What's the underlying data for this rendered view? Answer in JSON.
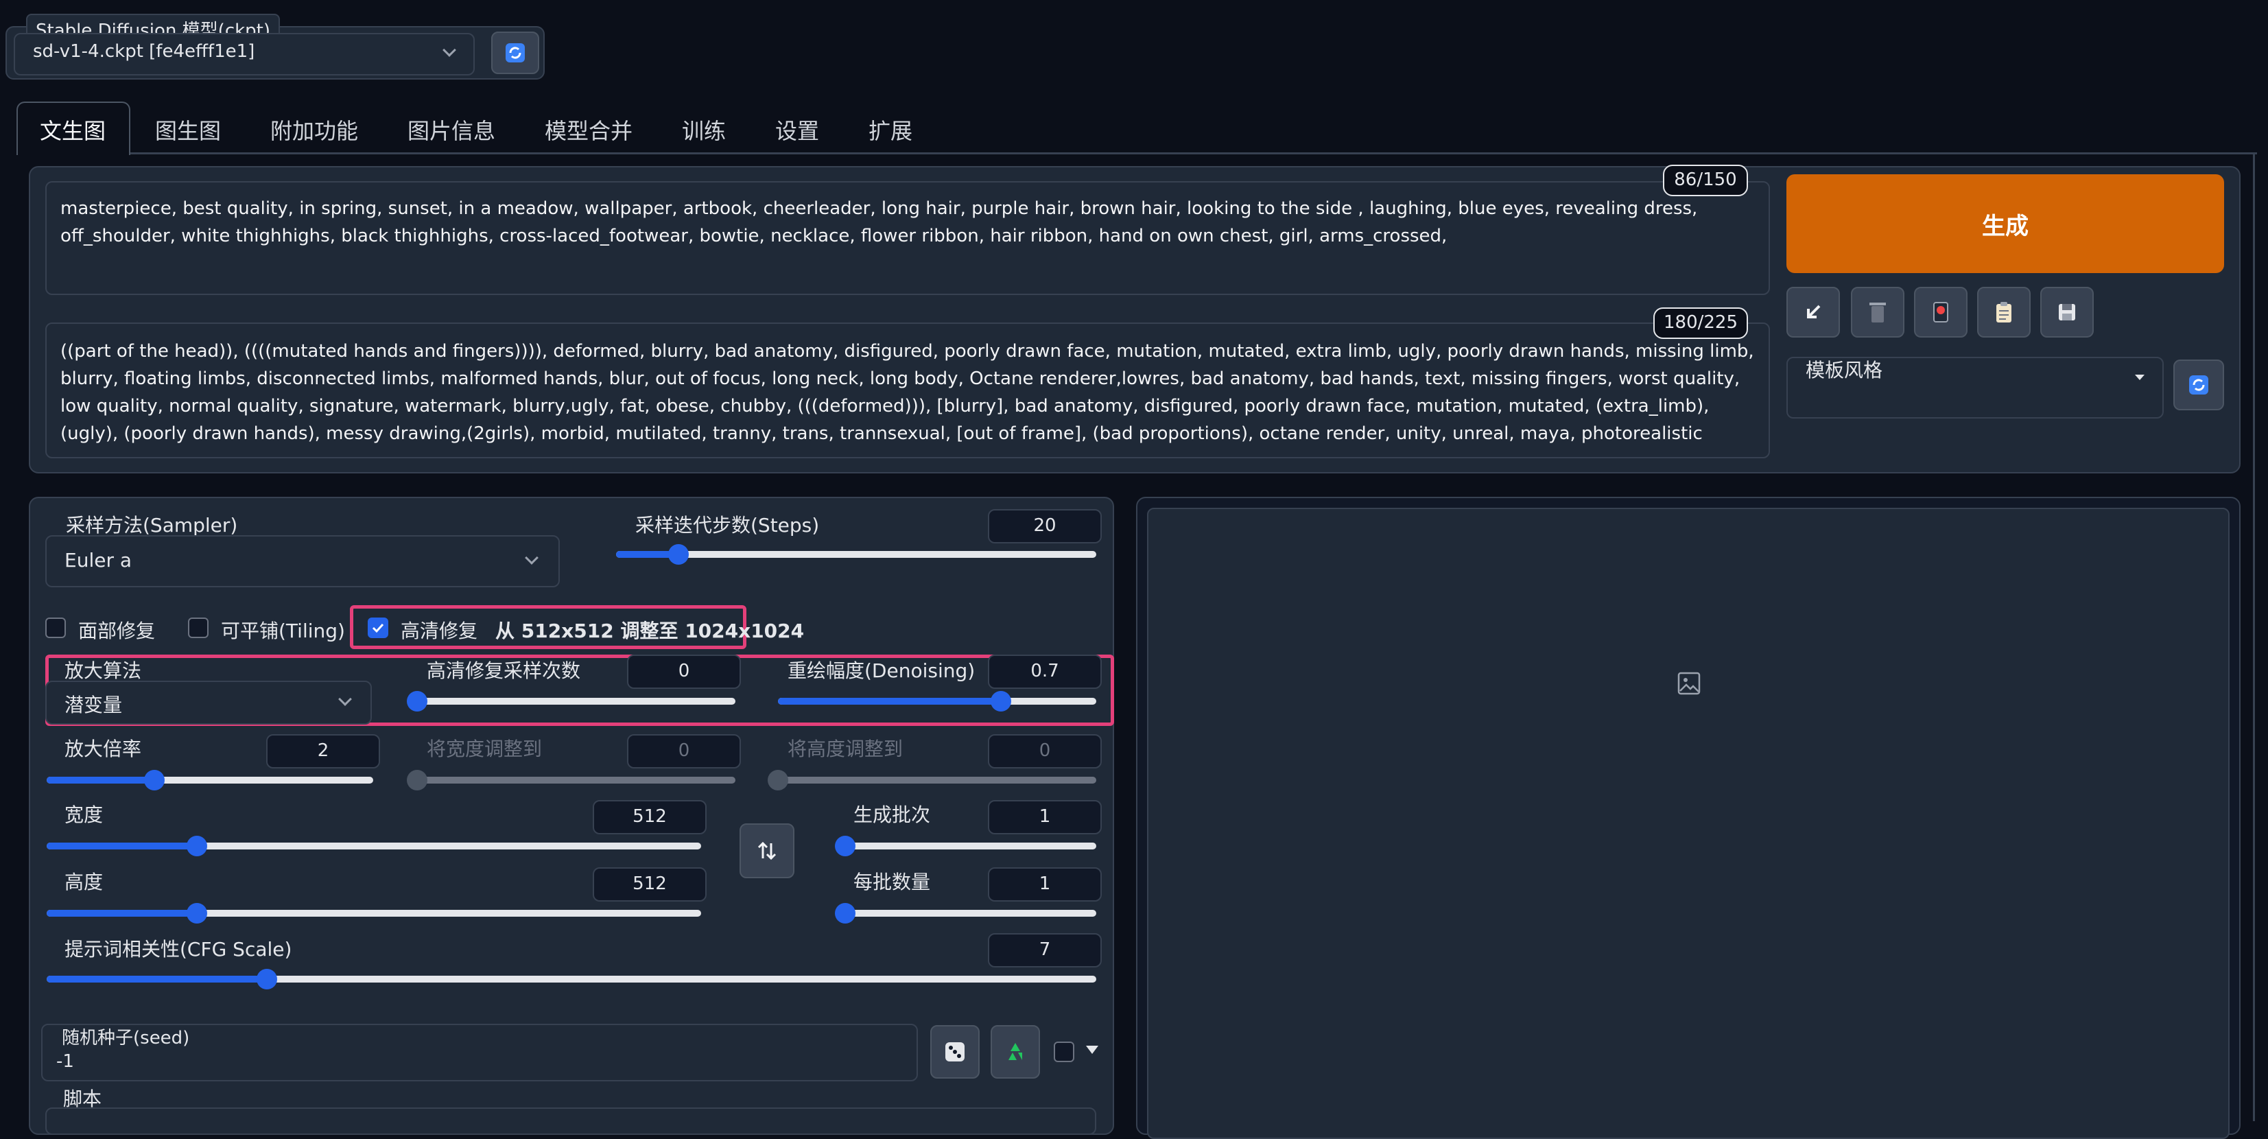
{
  "model": {
    "label": "Stable Diffusion 模型(ckpt)",
    "value": "sd-v1-4.ckpt [fe4efff1e1]"
  },
  "tabs": [
    "文生图",
    "图生图",
    "附加功能",
    "图片信息",
    "模型合并",
    "训练",
    "设置",
    "扩展"
  ],
  "prompt": {
    "counter": "86/150",
    "text": "masterpiece, best quality, in spring, sunset, in a meadow, wallpaper, artbook, cheerleader, long hair, purple hair, brown hair, looking to the side , laughing, blue eyes, revealing dress, off_shoulder, white thighhighs, black thighhighs, cross-laced_footwear, bowtie, necklace, flower ribbon, hair ribbon, hand on own chest, girl, arms_crossed,"
  },
  "negative_prompt": {
    "counter": "180/225",
    "text": "((part of the head)), ((((mutated hands and fingers)))), deformed, blurry, bad anatomy, disfigured, poorly drawn face, mutation, mutated, extra limb, ugly, poorly drawn hands, missing limb, blurry, floating limbs, disconnected limbs, malformed hands, blur, out of focus, long neck, long body, Octane renderer,lowres, bad anatomy, bad hands, text, missing fingers, worst quality, low quality, normal quality, signature, watermark, blurry,ugly, fat, obese, chubby, (((deformed))), [blurry], bad anatomy, disfigured, poorly drawn face, mutation, mutated, (extra_limb), (ugly), (poorly drawn hands), messy drawing,(2girls), morbid, mutilated, tranny, trans, trannsexual, [out of frame], (bad proportions), octane render, unity, unreal, maya, photorealistic"
  },
  "generate_label": "生成",
  "styles_label": "模板风格",
  "sampler": {
    "label": "采样方法(Sampler)",
    "value": "Euler a"
  },
  "steps": {
    "label": "采样迭代步数(Steps)",
    "value": "20",
    "fraction": 0.13
  },
  "face_restore_label": "面部修复",
  "tiling_label": "可平铺(Tiling)",
  "hires": {
    "label": "高清修复",
    "info": "从 512x512 调整至 1024x1024",
    "checked": true
  },
  "upscaler": {
    "label": "放大算法",
    "value": "潜变量"
  },
  "hires_steps": {
    "label": "高清修复采样次数",
    "value": "0",
    "fraction": 0.0
  },
  "denoising": {
    "label": "重绘幅度(Denoising)",
    "value": "0.7",
    "fraction": 0.7
  },
  "upscale_by": {
    "label": "放大倍率",
    "value": "2",
    "fraction": 0.33
  },
  "resize_width": {
    "label": "将宽度调整到",
    "value": "0",
    "fraction": 0.0
  },
  "resize_height": {
    "label": "将高度调整到",
    "value": "0",
    "fraction": 0.0
  },
  "width": {
    "label": "宽度",
    "value": "512",
    "fraction": 0.23
  },
  "height": {
    "label": "高度",
    "value": "512",
    "fraction": 0.23
  },
  "batch_count": {
    "label": "生成批次",
    "value": "1",
    "fraction": 0.0
  },
  "batch_size": {
    "label": "每批数量",
    "value": "1",
    "fraction": 0.0
  },
  "cfg": {
    "label": "提示词相关性(CFG Scale)",
    "value": "7",
    "fraction": 0.21
  },
  "seed": {
    "label": "随机种子(seed)",
    "value": "-1"
  },
  "script_label": "脚本",
  "colors": {
    "accent": "#2563eb",
    "generate": "#d26405",
    "highlight": "#e4407a"
  }
}
